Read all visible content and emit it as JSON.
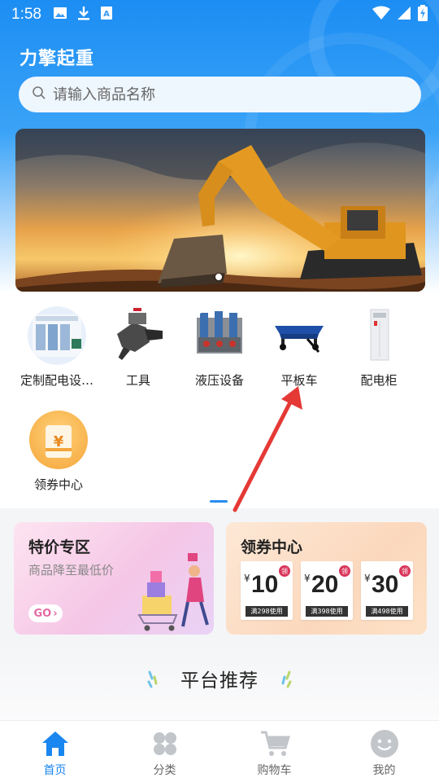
{
  "status_bar": {
    "time": "1:58",
    "icons_left": [
      "image-icon",
      "download-icon",
      "text-icon"
    ],
    "icons_right": [
      "wifi-icon",
      "signal-icon",
      "battery-charging-icon"
    ]
  },
  "header": {
    "app_title": "力擎起重",
    "search": {
      "placeholder": "请输入商品名称",
      "value": ""
    }
  },
  "banner": {
    "image": "excavator-sunset",
    "page_count": 1,
    "active_page": 1
  },
  "categories": [
    {
      "label": "定制配电设…",
      "icon": "distribution-panel-image"
    },
    {
      "label": "工具",
      "icon": "tool-image"
    },
    {
      "label": "液压设备",
      "icon": "hydraulic-equipment-image"
    },
    {
      "label": "平板车",
      "icon": "flatbed-cart-image"
    },
    {
      "label": "配电柜",
      "icon": "distribution-cabinet-image"
    },
    {
      "label": "领券中心",
      "icon": "coupon-yen-icon"
    }
  ],
  "promo": {
    "special": {
      "title": "特价专区",
      "subtitle": "商品降至最低价",
      "go_label": "GO"
    },
    "coupon_center": {
      "title": "领券中心",
      "coupons": [
        {
          "currency": "¥",
          "value": "10",
          "tag": "领",
          "condition": "满298使用"
        },
        {
          "currency": "¥",
          "value": "20",
          "tag": "领",
          "condition": "满398使用"
        },
        {
          "currency": "¥",
          "value": "30",
          "tag": "领",
          "condition": "满498使用"
        }
      ]
    }
  },
  "recommend": {
    "title": "平台推荐"
  },
  "tab_bar": {
    "active": "首页",
    "items": [
      {
        "label": "首页",
        "icon": "home-icon"
      },
      {
        "label": "分类",
        "icon": "category-icon"
      },
      {
        "label": "购物车",
        "icon": "cart-icon"
      },
      {
        "label": "我的",
        "icon": "profile-icon"
      }
    ]
  },
  "colors": {
    "primary": "#1a86ef",
    "header_top": "#1c8df3",
    "annotation_arrow": "#e53935",
    "coupon_tag": "#d9365a"
  }
}
